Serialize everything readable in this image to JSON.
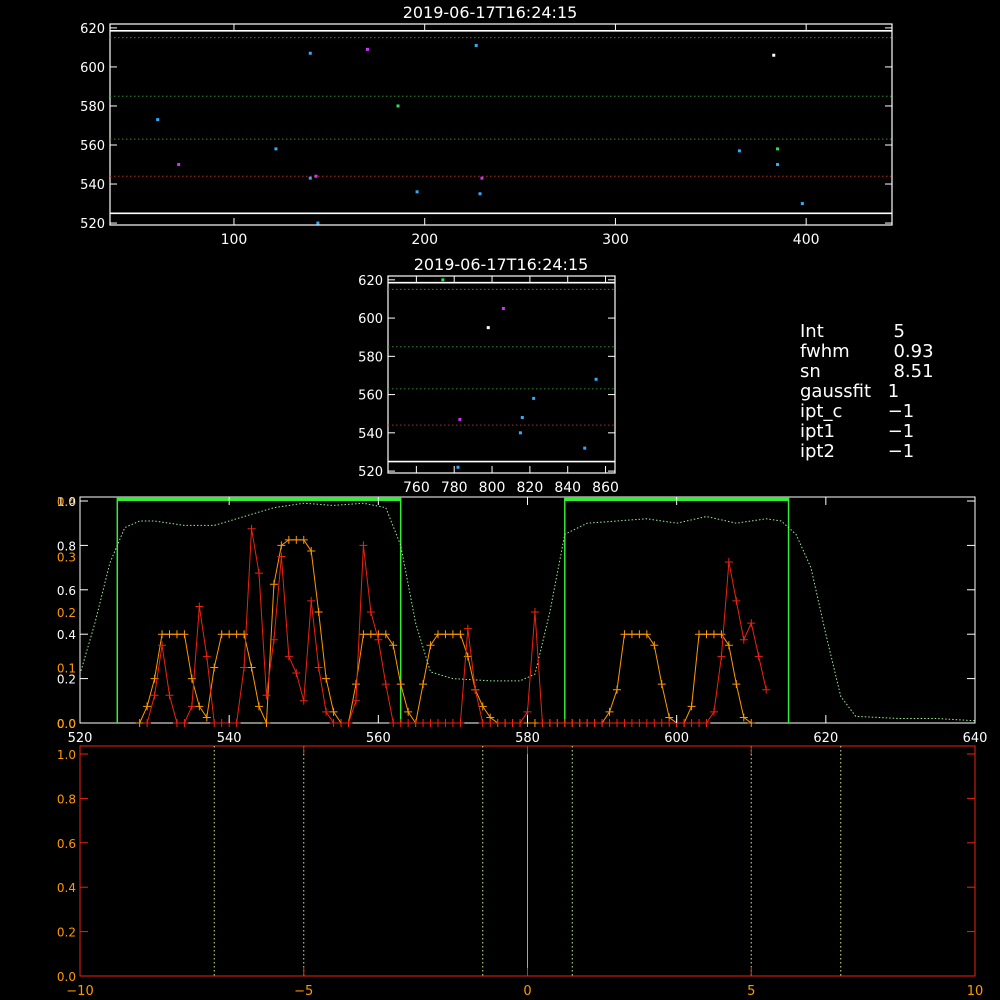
{
  "panels": {
    "top": {
      "title": "2019-06-17T16:24:15",
      "xlim": [
        35,
        445
      ],
      "ylim": [
        519,
        622
      ],
      "xticks": [
        100,
        200,
        300,
        400
      ],
      "yticks": [
        520,
        540,
        560,
        580,
        600,
        620
      ],
      "frame_color": "#ffffff",
      "hlines": [
        {
          "y": 618.5,
          "color": "#ffffff",
          "style": "solid"
        },
        {
          "y": 615,
          "color": "#2e8b2e",
          "style": "dotted"
        },
        {
          "y": 585,
          "color": "#2e8b2e",
          "style": "dotted"
        },
        {
          "y": 563,
          "color": "#2e8b2e",
          "style": "dotted"
        },
        {
          "y": 544,
          "color": "#b03020",
          "style": "dotted"
        },
        {
          "y": 525,
          "color": "#ffffff",
          "style": "solid"
        }
      ],
      "points": [
        {
          "x": 60,
          "y": 573,
          "color": "#33aaff"
        },
        {
          "x": 71,
          "y": 550,
          "color": "#cc33ff"
        },
        {
          "x": 122,
          "y": 558,
          "color": "#33aaff"
        },
        {
          "x": 140,
          "y": 607,
          "color": "#33aaff"
        },
        {
          "x": 140,
          "y": 543,
          "color": "#33aaff"
        },
        {
          "x": 143,
          "y": 544,
          "color": "#cc33ff"
        },
        {
          "x": 144,
          "y": 520,
          "color": "#33aaff"
        },
        {
          "x": 170,
          "y": 609,
          "color": "#cc33ff"
        },
        {
          "x": 186,
          "y": 580,
          "color": "#33dd55"
        },
        {
          "x": 196,
          "y": 536,
          "color": "#33aaff"
        },
        {
          "x": 227,
          "y": 611,
          "color": "#33aaff"
        },
        {
          "x": 229,
          "y": 535,
          "color": "#33aaff"
        },
        {
          "x": 230,
          "y": 543,
          "color": "#cc33ff"
        },
        {
          "x": 365,
          "y": 557,
          "color": "#33aaff"
        },
        {
          "x": 383,
          "y": 606,
          "color": "#ffffff"
        },
        {
          "x": 385,
          "y": 558,
          "color": "#33dd55"
        },
        {
          "x": 385,
          "y": 550,
          "color": "#33aaff"
        },
        {
          "x": 398,
          "y": 530,
          "color": "#33aaff"
        }
      ]
    },
    "middle": {
      "title": "2019-06-17T16:24:15",
      "xlim": [
        745,
        865
      ],
      "ylim": [
        519,
        622
      ],
      "xticks": [
        760,
        780,
        800,
        820,
        840,
        860
      ],
      "yticks": [
        520,
        540,
        560,
        580,
        600,
        620
      ],
      "frame_color": "#ffffff",
      "hlines": [
        {
          "y": 618.5,
          "color": "#ffffff",
          "style": "solid"
        },
        {
          "y": 615,
          "color": "#2e8b2e",
          "style": "dotted"
        },
        {
          "y": 585,
          "color": "#2e8b2e",
          "style": "dotted"
        },
        {
          "y": 563,
          "color": "#2e8b2e",
          "style": "dotted"
        },
        {
          "y": 544,
          "color": "#b03020",
          "style": "dotted"
        },
        {
          "y": 525,
          "color": "#ffffff",
          "style": "solid"
        }
      ],
      "points": [
        {
          "x": 774,
          "y": 620,
          "color": "#33dd55"
        },
        {
          "x": 782,
          "y": 522,
          "color": "#33aaff"
        },
        {
          "x": 783,
          "y": 547,
          "color": "#cc33ff"
        },
        {
          "x": 798,
          "y": 595,
          "color": "#ffffff"
        },
        {
          "x": 806,
          "y": 605,
          "color": "#cc33ff"
        },
        {
          "x": 815,
          "y": 540,
          "color": "#33aaff"
        },
        {
          "x": 816,
          "y": 548,
          "color": "#33aaff"
        },
        {
          "x": 822,
          "y": 558,
          "color": "#33aaff"
        },
        {
          "x": 849,
          "y": 532,
          "color": "#33aaff"
        },
        {
          "x": 855,
          "y": 568,
          "color": "#33aaff"
        }
      ]
    },
    "spectrum": {
      "xlim": [
        520,
        640
      ],
      "xticks": [
        520,
        540,
        560,
        580,
        600,
        620,
        640
      ],
      "left_axis_white": {
        "range": [
          0,
          1.0
        ],
        "ticks": [
          "0.0",
          "0.2",
          "0.4",
          "0.6",
          "0.8",
          "1.0"
        ],
        "values": [
          0,
          0.2,
          0.4,
          0.6,
          0.8,
          1.0
        ]
      },
      "left_axis_orange": {
        "range": [
          0,
          0.4
        ],
        "ticks": [
          "0.0",
          "0.1",
          "0.2",
          "0.3",
          "0.4"
        ],
        "values": [
          0,
          0.1,
          0.2,
          0.3,
          0.4
        ]
      },
      "frame_color": "#ffffff",
      "bands": [
        {
          "x0": 525,
          "x1": 563,
          "color": "#33ee33"
        },
        {
          "x0": 585,
          "x1": 615,
          "color": "#33ee33"
        }
      ],
      "transmission": {
        "color": "#99ee99",
        "x": [
          520,
          522,
          524,
          526,
          528,
          530,
          534,
          538,
          542,
          546,
          550,
          554,
          558,
          561,
          563,
          565,
          567,
          570,
          575,
          579,
          581,
          583,
          585,
          588,
          592,
          596,
          600,
          604,
          608,
          612,
          614,
          616,
          618,
          620,
          622,
          624,
          630,
          635,
          640
        ],
        "y": [
          0.22,
          0.45,
          0.72,
          0.88,
          0.91,
          0.91,
          0.89,
          0.89,
          0.93,
          0.97,
          0.99,
          0.98,
          0.99,
          0.97,
          0.8,
          0.45,
          0.23,
          0.2,
          0.19,
          0.19,
          0.22,
          0.5,
          0.85,
          0.9,
          0.91,
          0.92,
          0.9,
          0.93,
          0.9,
          0.92,
          0.91,
          0.85,
          0.7,
          0.4,
          0.12,
          0.03,
          0.02,
          0.02,
          0.01
        ]
      },
      "orange_series": {
        "color": "#ff9900",
        "x": [
          528,
          529,
          530,
          531,
          532,
          533,
          534,
          535,
          536,
          537,
          538,
          539,
          540,
          541,
          542,
          543,
          544,
          545,
          546,
          547,
          548,
          549,
          550,
          551,
          552,
          553,
          554,
          555,
          556,
          557,
          558,
          559,
          560,
          561,
          562,
          563,
          564,
          565,
          566,
          567,
          568,
          569,
          570,
          571,
          572,
          573,
          574,
          575,
          576,
          577,
          578,
          579,
          580,
          581,
          582,
          583,
          584,
          585,
          586,
          587,
          588,
          589,
          590,
          591,
          592,
          593,
          594,
          595,
          596,
          597,
          598,
          599,
          600,
          601,
          602,
          603,
          604,
          605,
          606,
          607,
          608,
          609,
          610
        ],
        "y": [
          0,
          0.03,
          0.08,
          0.16,
          0.16,
          0.16,
          0.16,
          0.08,
          0.03,
          0.01,
          0.1,
          0.16,
          0.16,
          0.16,
          0.16,
          0.1,
          0.03,
          0,
          0.25,
          0.32,
          0.33,
          0.33,
          0.33,
          0.31,
          0.2,
          0.08,
          0.02,
          0,
          0,
          0.07,
          0.16,
          0.16,
          0.16,
          0.16,
          0.14,
          0.07,
          0.02,
          0,
          0.07,
          0.14,
          0.16,
          0.16,
          0.16,
          0.16,
          0.12,
          0.06,
          0.03,
          0.01,
          0,
          0,
          0,
          0,
          0,
          0,
          0,
          0,
          0,
          0,
          0,
          0,
          0,
          0,
          0,
          0.02,
          0.06,
          0.16,
          0.16,
          0.16,
          0.16,
          0.14,
          0.07,
          0.01,
          0,
          0,
          0.03,
          0.16,
          0.16,
          0.16,
          0.16,
          0.14,
          0.07,
          0.01,
          0
        ]
      },
      "red_series": {
        "color": "#ee2211",
        "x": [
          529,
          530,
          531,
          532,
          533,
          534,
          535,
          536,
          537,
          538,
          539,
          540,
          541,
          542,
          543,
          544,
          545,
          546,
          547,
          548,
          549,
          550,
          551,
          552,
          553,
          554,
          555,
          556,
          557,
          558,
          559,
          560,
          561,
          562,
          563,
          564,
          565,
          566,
          567,
          568,
          569,
          570,
          571,
          572,
          573,
          574,
          575,
          576,
          577,
          578,
          579,
          580,
          581,
          582,
          583,
          584,
          585,
          586,
          587,
          588,
          589,
          590,
          591,
          592,
          593,
          594,
          595,
          596,
          597,
          598,
          599,
          600,
          601,
          602,
          603,
          604,
          605,
          606,
          607,
          608,
          609,
          610,
          611,
          612
        ],
        "y": [
          0,
          0.05,
          0.14,
          0.05,
          0,
          0,
          0.03,
          0.21,
          0.12,
          0,
          0,
          0,
          0,
          0.1,
          0.35,
          0.27,
          0.05,
          0.15,
          0.3,
          0.12,
          0.09,
          0.04,
          0.22,
          0.1,
          0.02,
          0,
          0,
          0,
          0.04,
          0.32,
          0.2,
          0.15,
          0.07,
          0,
          0,
          0,
          0,
          0,
          0,
          0,
          0,
          0,
          0,
          0.17,
          0.06,
          0,
          0,
          0,
          0,
          0,
          0,
          0.02,
          0.2,
          0,
          0,
          0,
          0,
          0,
          0,
          0,
          0,
          0,
          0,
          0,
          0,
          0,
          0,
          0,
          0,
          0,
          0,
          0,
          0,
          0,
          0,
          0,
          0.02,
          0.12,
          0.29,
          0.22,
          0.15,
          0.18,
          0.12,
          0.06
        ]
      }
    },
    "bottom": {
      "xlim": [
        -10,
        10
      ],
      "ylim": [
        0,
        1.0
      ],
      "xticks": [
        -10,
        -5,
        0,
        5,
        10
      ],
      "yticks": [
        "0.0",
        "0.2",
        "0.4",
        "0.6",
        "0.8",
        "1.0"
      ],
      "ytick_values": [
        0,
        0.2,
        0.4,
        0.6,
        0.8,
        1.0
      ],
      "frame_color": "#ee2211",
      "label_color": "#ff9900",
      "vlines": [
        {
          "x": -7,
          "color": "#ccee88",
          "style": "dotted"
        },
        {
          "x": -5,
          "color": "#ccee88",
          "style": "dotted"
        },
        {
          "x": -1,
          "color": "#ccee88",
          "style": "dotted"
        },
        {
          "x": 1,
          "color": "#ccee88",
          "style": "dotted"
        },
        {
          "x": 5,
          "color": "#ccee88",
          "style": "dotted"
        },
        {
          "x": 7,
          "color": "#ccee88",
          "style": "dotted"
        },
        {
          "x": 0,
          "color": "#ff9900",
          "style": "solid"
        }
      ]
    }
  },
  "info": {
    "rows": [
      {
        "key": "Int",
        "value": "  5"
      },
      {
        "key": "fwhm",
        "value": "  0.93"
      },
      {
        "key": "sn",
        "value": "  8.51"
      },
      {
        "key": "gaussfit",
        "value": " 1"
      },
      {
        "key": "ipt_c",
        "value": " −1"
      },
      {
        "key": "ipt1",
        "value": " −1"
      },
      {
        "key": "ipt2",
        "value": " −1"
      }
    ]
  },
  "chart_data": [
    {
      "type": "scatter",
      "title": "2019-06-17T16:24:15",
      "xlim": [
        35,
        445
      ],
      "ylim": [
        519,
        622
      ],
      "note_source": "panels.top.points"
    },
    {
      "type": "scatter",
      "title": "2019-06-17T16:24:15",
      "xlim": [
        745,
        865
      ],
      "ylim": [
        519,
        622
      ],
      "note_source": "panels.middle.points"
    },
    {
      "type": "line",
      "title": "",
      "xlim": [
        520,
        640
      ],
      "note_source": "panels.spectrum"
    },
    {
      "type": "line",
      "title": "",
      "xlim": [
        -10,
        10
      ],
      "ylim": [
        0,
        1.0
      ],
      "note_source": "panels.bottom"
    }
  ]
}
